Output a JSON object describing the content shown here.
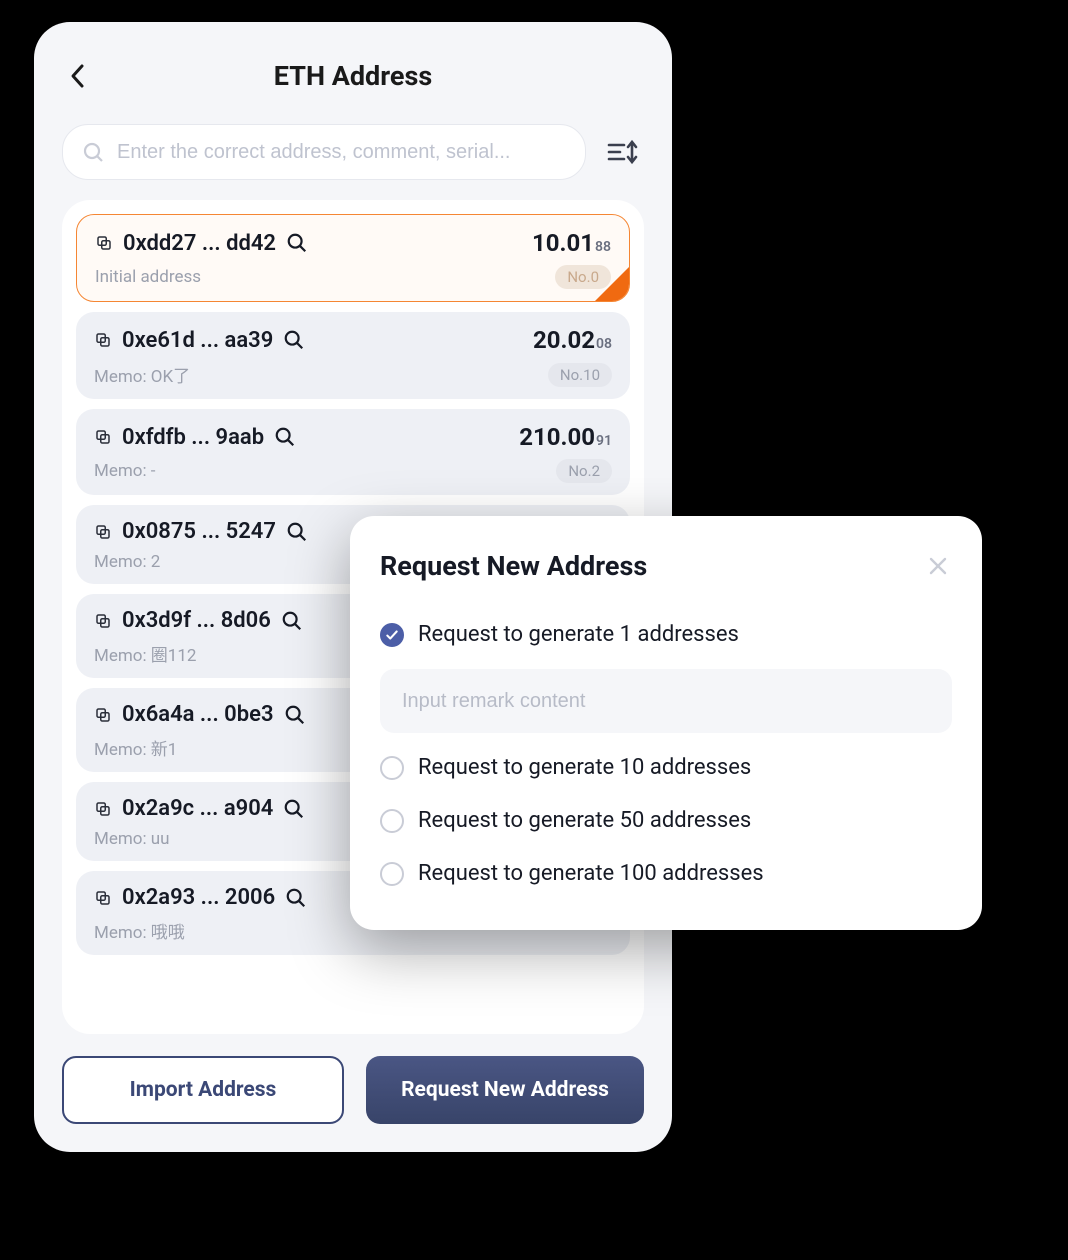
{
  "header": {
    "title": "ETH Address"
  },
  "search": {
    "placeholder": "Enter the correct address, comment, serial..."
  },
  "addresses": [
    {
      "addr": "0xdd27 ... dd42",
      "balance_main": "10.01",
      "balance_sub": "88",
      "memo": "Initial address",
      "badge": "No.0",
      "selected": true
    },
    {
      "addr": "0xe61d ... aa39",
      "balance_main": "20.02",
      "balance_sub": "08",
      "memo": "Memo: OK了",
      "badge": "No.10",
      "selected": false
    },
    {
      "addr": "0xfdfb ... 9aab",
      "balance_main": "210.00",
      "balance_sub": "91",
      "memo": "Memo: -",
      "badge": "No.2",
      "selected": false
    },
    {
      "addr": "0x0875 ... 5247",
      "balance_main": "",
      "balance_sub": "",
      "memo": "Memo: 2",
      "badge": "",
      "selected": false
    },
    {
      "addr": "0x3d9f ... 8d06",
      "balance_main": "",
      "balance_sub": "",
      "memo": "Memo: 圈112",
      "badge": "",
      "selected": false
    },
    {
      "addr": "0x6a4a ... 0be3",
      "balance_main": "",
      "balance_sub": "",
      "memo": "Memo: 新1",
      "badge": "",
      "selected": false
    },
    {
      "addr": "0x2a9c ... a904",
      "balance_main": "",
      "balance_sub": "",
      "memo": "Memo: uu",
      "badge": "",
      "selected": false
    },
    {
      "addr": "0x2a93 ... 2006",
      "balance_main": "",
      "balance_sub": "",
      "memo": "Memo: 哦哦",
      "badge": "",
      "selected": false
    }
  ],
  "buttons": {
    "import": "Import Address",
    "request": "Request New Address"
  },
  "modal": {
    "title": "Request New Address",
    "remark_placeholder": "Input remark content",
    "options": [
      {
        "label": "Request to generate 1 addresses",
        "checked": true
      },
      {
        "label": "Request to generate 10 addresses",
        "checked": false
      },
      {
        "label": "Request to generate 50 addresses",
        "checked": false
      },
      {
        "label": "Request to generate 100 addresses",
        "checked": false
      }
    ]
  }
}
